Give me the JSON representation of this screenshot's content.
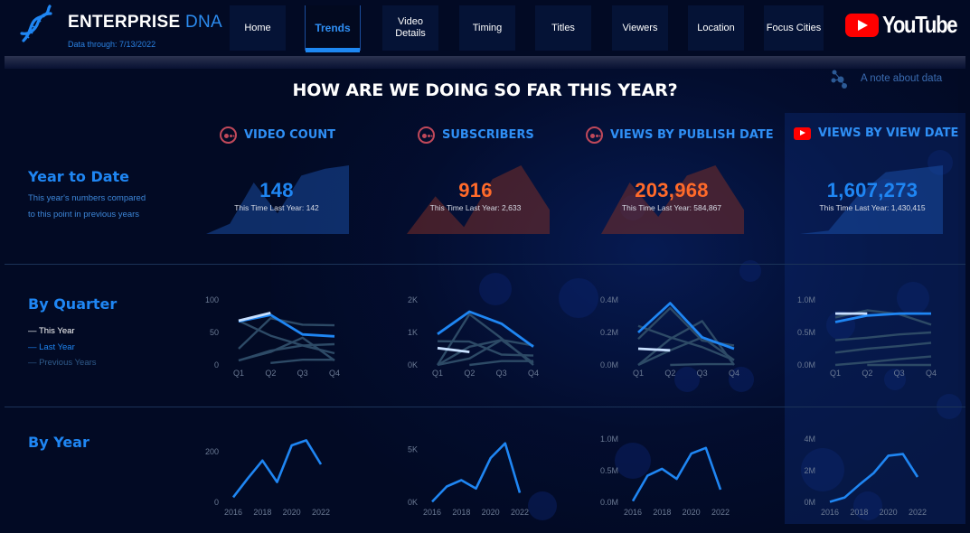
{
  "header": {
    "brand_bold": "ENTERPRISE",
    "brand_light": "DNA",
    "data_through": "Data through: 7/13/2022",
    "logo_icon": "dna-helix-icon",
    "nav": [
      {
        "label": "Home",
        "active": false
      },
      {
        "label": "Trends",
        "active": true
      },
      {
        "label": "Video Details",
        "active": false
      },
      {
        "label": "Timing",
        "active": false
      },
      {
        "label": "Titles",
        "active": false
      },
      {
        "label": "Viewers",
        "active": false
      },
      {
        "label": "Location",
        "active": false
      },
      {
        "label": "Focus Cities",
        "active": false
      }
    ],
    "youtube_logo_text": "YouTube"
  },
  "note_link": {
    "label": "A note about data",
    "icon": "network-nodes-icon"
  },
  "page_title": "HOW ARE WE DOING SO FAR THIS YEAR?",
  "metrics": [
    {
      "title": "VIDEO COUNT",
      "icon": "channel-circle-icon"
    },
    {
      "title": "SUBSCRIBERS",
      "icon": "channel-circle-icon"
    },
    {
      "title": "VIEWS BY PUBLISH DATE",
      "icon": "channel-circle-icon"
    },
    {
      "title": "VIEWS BY VIEW DATE",
      "icon": "youtube-play-icon"
    }
  ],
  "sections": {
    "ytd": {
      "title": "Year to Date",
      "subtitle_line1": "This year's numbers compared",
      "subtitle_line2": "to this point in previous years"
    },
    "quarter": {
      "title": "By Quarter",
      "legend": [
        {
          "label": "— This Year",
          "color": "#ffffff"
        },
        {
          "label": "— Last Year",
          "color": "#1f86f3"
        },
        {
          "label": "— Previous Years",
          "color": "#2f5a8a"
        }
      ]
    },
    "year": {
      "title": "By Year"
    }
  },
  "colors": {
    "accent_blue": "#1f86f3",
    "accent_orange": "#ff6a2a",
    "this_year": "#c8e0ff",
    "previous_years": "#2d4a66"
  },
  "chart_data": [
    {
      "type": "area",
      "title": "VIDEO COUNT - Year to Date",
      "value_label": "148",
      "comparison_label": "This Time Last Year: 142",
      "value": 148,
      "last_year": 142,
      "color": "#1f86f3",
      "trend_shape": [
        0,
        0.15,
        0.75,
        0.3,
        0.85,
        0.95,
        1.0
      ]
    },
    {
      "type": "area",
      "title": "SUBSCRIBERS - Year to Date",
      "value_label": "916",
      "comparison_label": "This Time Last Year: 2,633",
      "value": 916,
      "last_year": 2633,
      "color": "#ff6a2a",
      "trend_shape": [
        0,
        0.55,
        0.1,
        0.8,
        1.0,
        0.35
      ]
    },
    {
      "type": "area",
      "title": "VIEWS BY PUBLISH DATE - Year to Date",
      "value_label": "203,968",
      "comparison_label": "This Time Last Year: 584,867",
      "value": 203968,
      "last_year": 584867,
      "color": "#ff6a2a",
      "trend_shape": [
        0,
        0.75,
        0.25,
        0.85,
        1.0,
        0.35
      ]
    },
    {
      "type": "area",
      "title": "VIEWS BY VIEW DATE - Year to Date",
      "value_label": "1,607,273",
      "comparison_label": "This Time Last Year: 1,430,415",
      "value": 1607273,
      "last_year": 1430415,
      "color": "#1f86f3",
      "trend_shape": [
        0,
        0.05,
        0.55,
        0.9,
        0.95,
        1.0
      ]
    },
    {
      "type": "line",
      "title": "VIDEO COUNT by Quarter",
      "categories": [
        "Q1",
        "Q2",
        "Q3",
        "Q4"
      ],
      "yticks": [
        "0",
        "50",
        "100"
      ],
      "ylim": [
        0,
        100
      ],
      "series": [
        {
          "name": "This Year",
          "values": [
            68,
            80,
            null,
            null
          ]
        },
        {
          "name": "Last Year",
          "values": [
            67,
            77,
            47,
            44
          ]
        },
        {
          "name": "Previous Year A",
          "values": [
            68,
            45,
            30,
            18
          ]
        },
        {
          "name": "Previous Year B",
          "values": [
            25,
            72,
            62,
            61
          ]
        },
        {
          "name": "Previous Year C",
          "values": [
            7,
            20,
            42,
            7
          ]
        },
        {
          "name": "Previous Year D",
          "values": [
            7,
            22,
            30,
            32
          ]
        },
        {
          "name": "Previous Year E",
          "values": [
            null,
            3,
            8,
            8
          ]
        }
      ]
    },
    {
      "type": "line",
      "title": "SUBSCRIBERS by Quarter",
      "categories": [
        "Q1",
        "Q2",
        "Q3",
        "Q4"
      ],
      "yticks": [
        "0K",
        "1K",
        "2K"
      ],
      "ylim": [
        0,
        2000
      ],
      "series": [
        {
          "name": "This Year",
          "values": [
            520,
            400,
            null,
            null
          ]
        },
        {
          "name": "Last Year",
          "values": [
            950,
            1640,
            1270,
            560
          ]
        },
        {
          "name": "Previous Year A",
          "values": [
            0,
            1560,
            820,
            0
          ]
        },
        {
          "name": "Previous Year B",
          "values": [
            730,
            720,
            320,
            290
          ]
        },
        {
          "name": "Previous Year C",
          "values": [
            0,
            560,
            770,
            600
          ]
        },
        {
          "name": "Previous Year D",
          "values": [
            0,
            200,
            770,
            60
          ]
        },
        {
          "name": "Previous Year E",
          "values": [
            null,
            0,
            120,
            120
          ]
        }
      ]
    },
    {
      "type": "line",
      "title": "VIEWS BY PUBLISH DATE by Quarter",
      "categories": [
        "Q1",
        "Q2",
        "Q3",
        "Q4"
      ],
      "yticks": [
        "0.0M",
        "0.2M",
        "0.4M"
      ],
      "ylim": [
        0,
        400000
      ],
      "series": [
        {
          "name": "This Year",
          "values": [
            100000,
            90000,
            null,
            null
          ]
        },
        {
          "name": "Last Year",
          "values": [
            200000,
            380000,
            170000,
            100000
          ]
        },
        {
          "name": "Previous Year A",
          "values": [
            160000,
            350000,
            150000,
            120000
          ]
        },
        {
          "name": "Previous Year B",
          "values": [
            240000,
            170000,
            110000,
            30000
          ]
        },
        {
          "name": "Previous Year C",
          "values": [
            0,
            160000,
            270000,
            0
          ]
        },
        {
          "name": "Previous Year D",
          "values": [
            0,
            90000,
            170000,
            30000
          ]
        },
        {
          "name": "Previous Year E",
          "values": [
            null,
            0,
            5000,
            5000
          ]
        }
      ]
    },
    {
      "type": "line",
      "title": "VIEWS BY VIEW DATE by Quarter",
      "categories": [
        "Q1",
        "Q2",
        "Q3",
        "Q4"
      ],
      "yticks": [
        "0.0M",
        "0.5M",
        "1.0M"
      ],
      "ylim": [
        0,
        1000000
      ],
      "series": [
        {
          "name": "This Year",
          "values": [
            790000,
            790000,
            null,
            null
          ]
        },
        {
          "name": "Last Year",
          "values": [
            660000,
            760000,
            790000,
            790000
          ]
        },
        {
          "name": "Previous Year A",
          "values": [
            730000,
            840000,
            780000,
            620000
          ]
        },
        {
          "name": "Previous Year B",
          "values": [
            380000,
            420000,
            470000,
            500000
          ]
        },
        {
          "name": "Previous Year C",
          "values": [
            190000,
            250000,
            290000,
            340000
          ]
        },
        {
          "name": "Previous Year D",
          "values": [
            0,
            40000,
            90000,
            130000
          ]
        },
        {
          "name": "Previous Year E",
          "values": [
            null,
            0,
            0,
            0
          ]
        }
      ]
    },
    {
      "type": "line",
      "title": "VIDEO COUNT by Year",
      "x": [
        2016,
        2017,
        2018,
        2019,
        2020,
        2021,
        2022
      ],
      "xticks": [
        "2016",
        "2018",
        "2020",
        "2022"
      ],
      "yticks": [
        "0",
        "200"
      ],
      "ylim": [
        0,
        250
      ],
      "values": [
        20,
        95,
        165,
        80,
        225,
        245,
        150
      ]
    },
    {
      "type": "line",
      "title": "SUBSCRIBERS by Year",
      "x": [
        2016,
        2017,
        2018,
        2019,
        2020,
        2021,
        2022
      ],
      "xticks": [
        "2016",
        "2018",
        "2020",
        "2022"
      ],
      "yticks": [
        "0K",
        "5K"
      ],
      "ylim": [
        0,
        6000
      ],
      "values": [
        50,
        1500,
        2100,
        1300,
        4200,
        5600,
        900
      ]
    },
    {
      "type": "line",
      "title": "VIEWS BY PUBLISH DATE by Year",
      "x": [
        2016,
        2017,
        2018,
        2019,
        2020,
        2021,
        2022
      ],
      "xticks": [
        "2016",
        "2018",
        "2020",
        "2022"
      ],
      "yticks": [
        "0.0M",
        "0.5M",
        "1.0M"
      ],
      "ylim": [
        0,
        1000000
      ],
      "values": [
        20000,
        420000,
        530000,
        370000,
        770000,
        860000,
        200000
      ]
    },
    {
      "type": "line",
      "title": "VIEWS BY VIEW DATE by Year",
      "x": [
        2016,
        2017,
        2018,
        2019,
        2020,
        2021,
        2022
      ],
      "xticks": [
        "2016",
        "2018",
        "2020",
        "2022"
      ],
      "yticks": [
        "0M",
        "2M",
        "4M"
      ],
      "ylim": [
        0,
        4000000
      ],
      "values": [
        30000,
        300000,
        1100000,
        1850000,
        2950000,
        3050000,
        1600000
      ]
    }
  ]
}
